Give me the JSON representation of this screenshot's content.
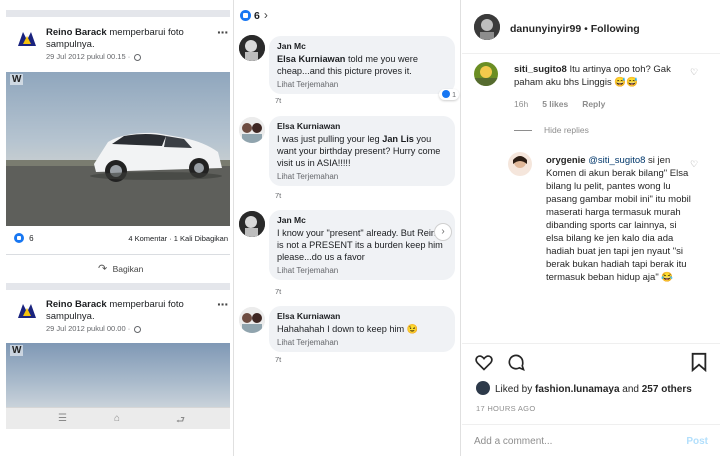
{
  "facebook": {
    "posts": [
      {
        "author": "Reino Barack",
        "action": "memperbarui foto sampulnya.",
        "date": "29 Jul 2012 pukul 00.15 ·",
        "photo_logo": "W"
      },
      {
        "author": "Reino Barack",
        "action": "memperbarui foto sampulnya.",
        "date": "29 Jul 2012 pukul 00.00 ·",
        "photo_logo": "W"
      }
    ],
    "reactions_count": "6",
    "comments_shares": "4 Komentar · 1 Kali Dibagikan",
    "share_label": "Bagikan"
  },
  "comments_panel": {
    "top_count": "6",
    "comments": [
      {
        "author": "Jan Mc",
        "mention": "Elsa Kurniawan",
        "text": " told me you were cheap...and this picture proves it.",
        "translate": "Lihat Terjemahan",
        "time": "7t",
        "reactions": "1"
      },
      {
        "author": "Elsa Kurniawan",
        "text_pre": "I was just pulling your leg ",
        "mention": "Jan Lis",
        "text": " you want your birthday present? Hurry come visit us in ASIA!!!!!",
        "translate": "Lihat Terjemahan",
        "time": "7t"
      },
      {
        "author": "Jan Mc",
        "text": "I know your \"present\" already. But Reino is not a PRESENT its a burden keep him please...do us a favor",
        "translate": "Lihat Terjemahan",
        "time": "7t"
      },
      {
        "author": "Elsa Kurniawan",
        "text": "Hahahahah I down to keep him 😉",
        "translate": "Lihat Terjemahan",
        "time": "7t"
      }
    ]
  },
  "instagram": {
    "username": "danunyinyir99",
    "follow_status": "Following",
    "comments": [
      {
        "user": "siti_sugito8",
        "text": "Itu artinya opo toh? Gak paham aku bhs Linggis 😅😅",
        "time": "16h",
        "likes": "5 likes",
        "reply": "Reply"
      }
    ],
    "hide_replies": "Hide replies",
    "reply": {
      "user": "orygenie",
      "mention": "@siti_sugito8",
      "text": " si jen Komen di akun berak bilang\" Elsa bilang lu pelit, pantes wong lu pasang gambar mobil ini\" itu mobil maserati harga termasuk murah dibanding sports car lainnya, si elsa bilang ke jen kalo dia ada hadiah buat jen tapi jen nyaut \"si berak bukan hadiah tapi berak itu termasuk beban hidup aja\" 😂"
    },
    "liked_by_prefix": "Liked by",
    "liked_by_user": "fashion.lunamaya",
    "liked_by_and": "and",
    "liked_by_others": "257 others",
    "timestamp": "17 HOURS AGO",
    "add_comment_placeholder": "Add a comment...",
    "post_label": "Post"
  }
}
